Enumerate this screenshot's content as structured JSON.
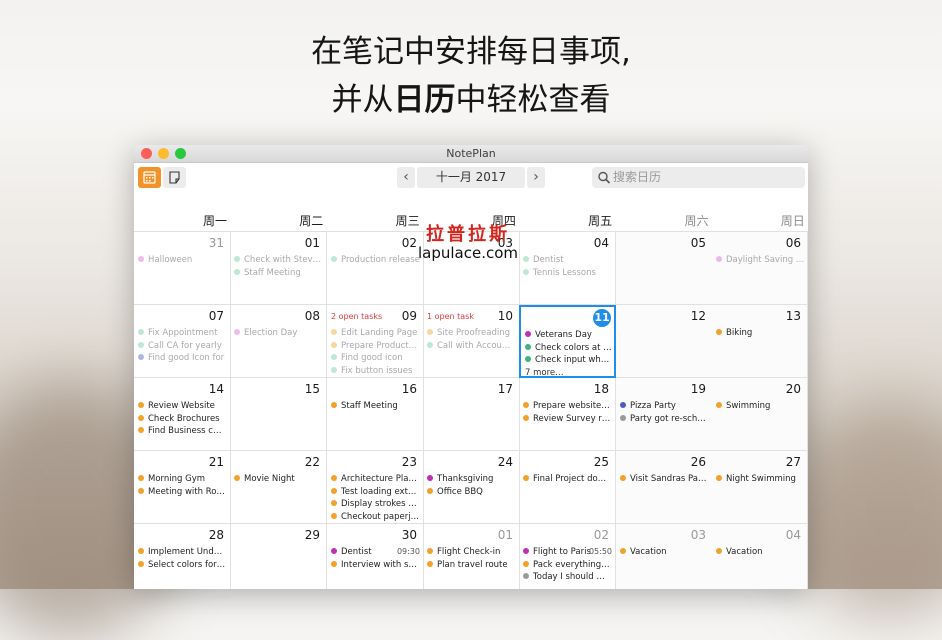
{
  "headline": {
    "line1": "在笔记中安排每日事项,",
    "line2_a": "并从",
    "line2_bold": "日历",
    "line2_b": "中轻松查看"
  },
  "window": {
    "title": "NotePlan"
  },
  "toolbar": {
    "month": "十一月 2017",
    "prev": "‹",
    "next": "›",
    "search_placeholder": "搜索日历",
    "calendar_view_icon": "calendar-icon",
    "notes_view_icon": "note-icon"
  },
  "weekdays": [
    "周一",
    "周二",
    "周三",
    "周四",
    "周五",
    "周六",
    "周日"
  ],
  "colors": {
    "orange": "#f2a12a",
    "purple": "#c12fb6",
    "green": "#3cb37a",
    "mint": "#6fcb9e",
    "blue": "#4b5cc4",
    "gray": "#9a9a9a",
    "today": "#1f8ee8",
    "alert": "#e23b3b"
  },
  "watermark": {
    "cn": "拉普拉斯",
    "en": "lapulace.com"
  },
  "weeks": [
    [
      {
        "day": "31",
        "dim": true,
        "events": [
          {
            "t": "Halloween",
            "c": "#d66ad0",
            "f": true
          }
        ]
      },
      {
        "day": "01",
        "events": [
          {
            "t": "Check with Stev…",
            "c": "#6fcb9e",
            "f": true
          },
          {
            "t": "Staff Meeting",
            "c": "#6fcb9e",
            "f": true
          }
        ]
      },
      {
        "day": "02",
        "events": [
          {
            "t": "Production release",
            "c": "#6fcb9e",
            "f": true
          }
        ]
      },
      {
        "day": "03",
        "events": []
      },
      {
        "day": "04",
        "events": [
          {
            "t": "Dentist",
            "c": "#6fcb9e",
            "f": true
          },
          {
            "t": "Tennis Lessons",
            "c": "#6fcb9e",
            "f": true
          }
        ]
      },
      {
        "day": "05",
        "events": []
      },
      {
        "day": "06",
        "events": [
          {
            "t": "Daylight Saving …",
            "c": "#d66ad0",
            "f": true
          }
        ]
      }
    ],
    [
      {
        "day": "07",
        "events": [
          {
            "t": "Fix Appointment",
            "c": "#6fcb9e",
            "f": true
          },
          {
            "t": "Call CA for yearly",
            "c": "#6fcb9e",
            "f": true
          },
          {
            "t": "Find good Icon for",
            "c": "#4b5cc4",
            "f": true
          }
        ]
      },
      {
        "day": "08",
        "events": [
          {
            "t": "Election Day",
            "c": "#d66ad0",
            "f": true
          }
        ]
      },
      {
        "day": "09",
        "tasks": "2 open tasks",
        "events": [
          {
            "t": "Edit Landing Page",
            "c": "#f2a12a",
            "f": true
          },
          {
            "t": "Prepare Product…",
            "c": "#f2a12a",
            "f": true
          },
          {
            "t": "Find good icon",
            "c": "#6fcb9e",
            "f": true
          },
          {
            "t": "Fix button issues",
            "c": "#6fcb9e",
            "f": true
          }
        ]
      },
      {
        "day": "10",
        "tasks": "1 open task",
        "events": [
          {
            "t": "Site Proofreading",
            "c": "#f2a12a",
            "f": true
          },
          {
            "t": "Call with Accou…",
            "c": "#6fcb9e",
            "f": true
          }
        ]
      },
      {
        "day": "11",
        "today": true,
        "events": [
          {
            "t": "Veterans Day",
            "c": "#c12fb6"
          },
          {
            "t": "Check colors at …",
            "c": "#3cb37a"
          },
          {
            "t": "Check input wh…",
            "c": "#3cb37a"
          }
        ],
        "more": "7 more…"
      },
      {
        "day": "12",
        "events": []
      },
      {
        "day": "13",
        "events": [
          {
            "t": "Biking",
            "c": "#f2a12a"
          }
        ]
      }
    ],
    [
      {
        "day": "14",
        "events": [
          {
            "t": "Review Website",
            "c": "#f2a12a"
          },
          {
            "t": "Check Brochures",
            "c": "#f2a12a"
          },
          {
            "t": "Find Business c…",
            "c": "#f2a12a"
          }
        ]
      },
      {
        "day": "15",
        "events": []
      },
      {
        "day": "16",
        "events": [
          {
            "t": "Staff Meeting",
            "c": "#f2a12a"
          }
        ]
      },
      {
        "day": "17",
        "events": []
      },
      {
        "day": "18",
        "events": [
          {
            "t": "Prepare website…",
            "c": "#f2a12a"
          },
          {
            "t": "Review Survey r…",
            "c": "#f2a12a"
          }
        ]
      },
      {
        "day": "19",
        "events": [
          {
            "t": "Pizza Party",
            "c": "#4b5cc4"
          },
          {
            "t": "Party got re-sch…",
            "c": "#9a9a9a"
          }
        ]
      },
      {
        "day": "20",
        "events": [
          {
            "t": "Swimming",
            "c": "#f2a12a"
          }
        ]
      }
    ],
    [
      {
        "day": "21",
        "events": [
          {
            "t": "Morning Gym",
            "c": "#f2a12a"
          },
          {
            "t": "Meeting with Ro…",
            "c": "#f2a12a"
          }
        ]
      },
      {
        "day": "22",
        "events": [
          {
            "t": "Movie Night",
            "c": "#f2a12a"
          }
        ]
      },
      {
        "day": "23",
        "events": [
          {
            "t": "Architecture Pla…",
            "c": "#f2a12a"
          },
          {
            "t": "Test loading ext…",
            "c": "#f2a12a"
          },
          {
            "t": "Display strokes …",
            "c": "#f2a12a"
          },
          {
            "t": "Checkout paperj…",
            "c": "#f2a12a"
          }
        ]
      },
      {
        "day": "24",
        "events": [
          {
            "t": "Thanksgiving",
            "c": "#c12fb6"
          },
          {
            "t": "Office BBQ",
            "c": "#f2a12a"
          }
        ]
      },
      {
        "day": "25",
        "events": [
          {
            "t": "Final Project do…",
            "c": "#f2a12a"
          }
        ]
      },
      {
        "day": "26",
        "events": [
          {
            "t": "Visit Sandras Pa…",
            "c": "#f2a12a"
          }
        ]
      },
      {
        "day": "27",
        "events": [
          {
            "t": "Night Swimming",
            "c": "#f2a12a"
          }
        ]
      }
    ],
    [
      {
        "day": "28",
        "events": [
          {
            "t": "Implement Und…",
            "c": "#f2a12a"
          },
          {
            "t": "Select colors for…",
            "c": "#f2a12a"
          }
        ]
      },
      {
        "day": "29",
        "events": []
      },
      {
        "day": "30",
        "time": "09:30",
        "events": [
          {
            "t": "Dentist",
            "c": "#c12fb6"
          },
          {
            "t": "Interview with s…",
            "c": "#f2a12a"
          }
        ]
      },
      {
        "day": "01",
        "dim": true,
        "events": [
          {
            "t": "Flight Check-in",
            "c": "#f2a12a"
          },
          {
            "t": "Plan travel route",
            "c": "#f2a12a"
          }
        ]
      },
      {
        "day": "02",
        "dim": true,
        "time": "05:50",
        "events": [
          {
            "t": "Flight to Paris",
            "c": "#c12fb6"
          },
          {
            "t": "Pack everything…",
            "c": "#f2a12a"
          },
          {
            "t": "Today I should …",
            "c": "#9a9a9a"
          }
        ]
      },
      {
        "day": "03",
        "dim": true,
        "events": [
          {
            "t": "Vacation",
            "c": "#f2a12a"
          }
        ]
      },
      {
        "day": "04",
        "dim": true,
        "events": [
          {
            "t": "Vacation",
            "c": "#f2a12a"
          }
        ]
      }
    ]
  ]
}
